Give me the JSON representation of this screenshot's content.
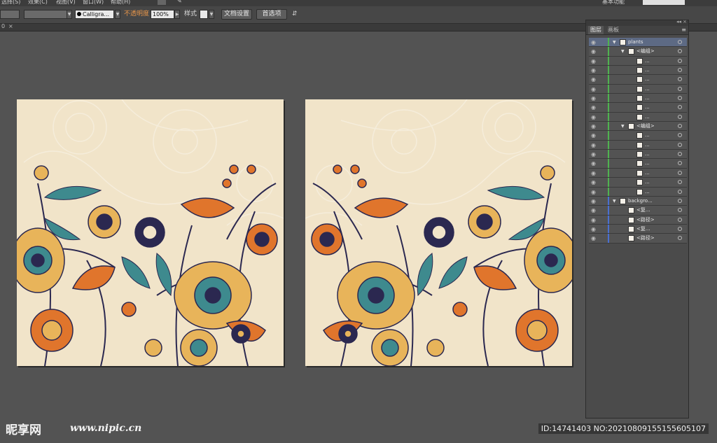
{
  "menu": {
    "items": [
      "选择(S)",
      "效果(C)",
      "视图(V)",
      "窗口(W)",
      "帮助(H)"
    ],
    "workspace": "基本功能"
  },
  "control_bar": {
    "brush_name": "Calligra...",
    "opacity_label": "不透明度",
    "opacity_value": "100%",
    "style_label": "样式",
    "doc_setup_button": "文档设置",
    "preferences_button": "首选项"
  },
  "tabs": {
    "close_symbol": "0"
  },
  "layers_panel": {
    "tabs": [
      "图层",
      "画板"
    ],
    "rows": [
      {
        "name": "plants",
        "indent": 0,
        "arrow": "▼",
        "selected": true,
        "color": "#4fb34f"
      },
      {
        "name": "<编组>",
        "indent": 1,
        "arrow": "▼",
        "selected": false,
        "color": "#4fb34f"
      },
      {
        "name": "...",
        "indent": 2,
        "arrow": "",
        "selected": false,
        "color": "#4fb34f"
      },
      {
        "name": "...",
        "indent": 2,
        "arrow": "",
        "selected": false,
        "color": "#4fb34f"
      },
      {
        "name": "...",
        "indent": 2,
        "arrow": "",
        "selected": false,
        "color": "#4fb34f"
      },
      {
        "name": "...",
        "indent": 2,
        "arrow": "",
        "selected": false,
        "color": "#4fb34f"
      },
      {
        "name": "...",
        "indent": 2,
        "arrow": "",
        "selected": false,
        "color": "#4fb34f"
      },
      {
        "name": "...",
        "indent": 2,
        "arrow": "",
        "selected": false,
        "color": "#4fb34f"
      },
      {
        "name": "...",
        "indent": 2,
        "arrow": "",
        "selected": false,
        "color": "#4fb34f"
      },
      {
        "name": "<编组>",
        "indent": 1,
        "arrow": "▼",
        "selected": false,
        "color": "#4fb34f"
      },
      {
        "name": "...",
        "indent": 2,
        "arrow": "",
        "selected": false,
        "color": "#4fb34f"
      },
      {
        "name": "...",
        "indent": 2,
        "arrow": "",
        "selected": false,
        "color": "#4fb34f"
      },
      {
        "name": "...",
        "indent": 2,
        "arrow": "",
        "selected": false,
        "color": "#4fb34f"
      },
      {
        "name": "...",
        "indent": 2,
        "arrow": "",
        "selected": false,
        "color": "#4fb34f"
      },
      {
        "name": "...",
        "indent": 2,
        "arrow": "",
        "selected": false,
        "color": "#4fb34f"
      },
      {
        "name": "...",
        "indent": 2,
        "arrow": "",
        "selected": false,
        "color": "#4fb34f"
      },
      {
        "name": "...",
        "indent": 2,
        "arrow": "",
        "selected": false,
        "color": "#4fb34f"
      },
      {
        "name": "backgro...",
        "indent": 0,
        "arrow": "▼",
        "selected": false,
        "color": "#4a6fd1"
      },
      {
        "name": "<复...",
        "indent": 1,
        "arrow": "",
        "selected": false,
        "color": "#4a6fd1"
      },
      {
        "name": "<路径>",
        "indent": 1,
        "arrow": "",
        "selected": false,
        "color": "#4a6fd1"
      },
      {
        "name": "<复...",
        "indent": 1,
        "arrow": "",
        "selected": false,
        "color": "#4a6fd1"
      },
      {
        "name": "<路径>",
        "indent": 1,
        "arrow": "",
        "selected": false,
        "color": "#4a6fd1"
      }
    ]
  },
  "watermark": {
    "logo": "昵享网",
    "url": "www.nipic.cn",
    "id": "ID:14741403 NO:20210809155155605107"
  },
  "colors": {
    "workspace": "#535353",
    "artboard_bg": "#f1e4c9",
    "accent_orange": "#e0752c",
    "teal": "#3e8a8e",
    "navy": "#2b2850",
    "gold": "#e8b45a"
  }
}
